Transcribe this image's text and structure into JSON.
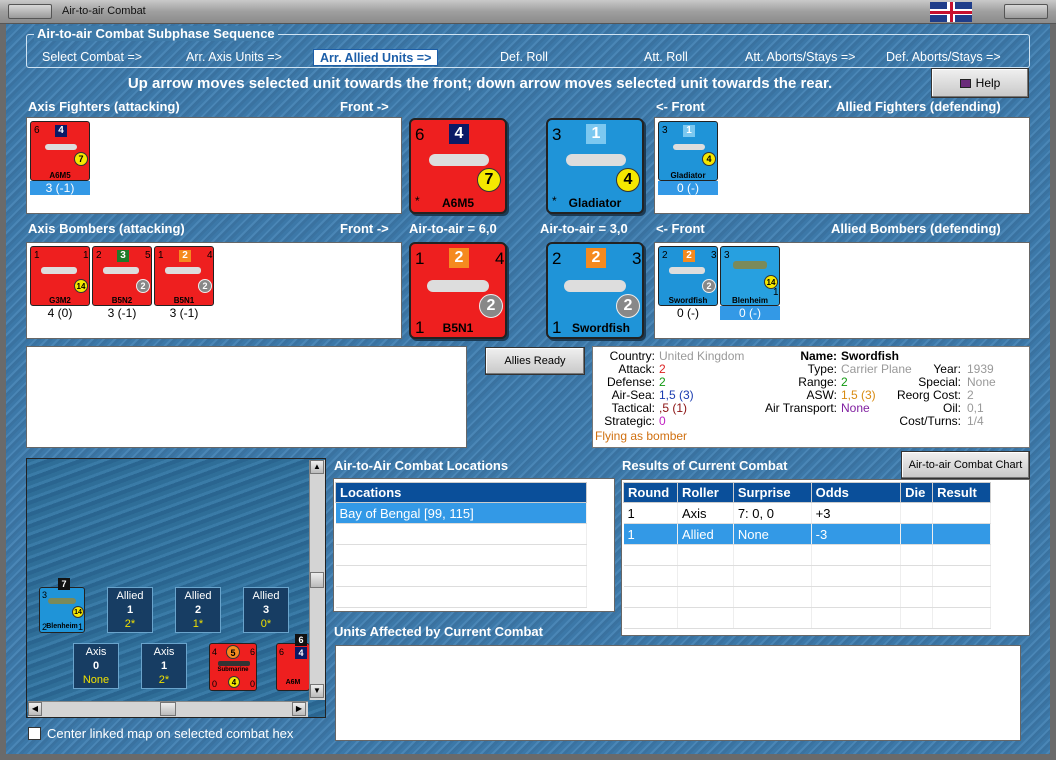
{
  "window": {
    "title": "Air-to-air Combat"
  },
  "sequence": {
    "title": "Air-to-air Combat Subphase Sequence",
    "items": [
      "Select Combat =>",
      "Arr. Axis Units =>",
      "Arr. Allied Units =>",
      "Def. Roll",
      "Att. Roll",
      "Att. Aborts/Stays =>",
      "Def. Aborts/Stays =>"
    ],
    "active": "Arr. Allied Units =>"
  },
  "instruction": "Up arrow moves selected unit towards the front; down arrow moves selected unit towards the rear.",
  "help_label": "Help",
  "labels": {
    "axis_fighters": "Axis Fighters (attacking)",
    "front_right": "Front ->",
    "front_left": "<- Front",
    "allied_fighters": "Allied Fighters (defending)",
    "axis_bombers": "Axis Bombers (attacking)",
    "allied_bombers": "Allied Bombers (defending)",
    "axis_air_to_air": "Air-to-air = 6,0",
    "allied_air_to_air": "Air-to-air = 3,0"
  },
  "axis_fighters": [
    {
      "name": "A6M5",
      "left": "6",
      "top": "4",
      "circle": "7",
      "sub": "3 (-1)",
      "selected": true
    }
  ],
  "allied_fighters": [
    {
      "name": "Gladiator",
      "left": "3",
      "top": "1",
      "circle": "4",
      "sub": "0 (-)",
      "selected": true
    }
  ],
  "axis_bombers": [
    {
      "name": "G3M2",
      "left": "1",
      "top": "",
      "right": "1",
      "circle": "14",
      "sub": "4 (0)"
    },
    {
      "name": "B5N2",
      "left": "2",
      "top": "3",
      "right": "5",
      "circle": "2",
      "sub": "3 (-1)"
    },
    {
      "name": "B5N1",
      "left": "1",
      "top": "2",
      "right": "4",
      "circle": "2",
      "sub": "3 (-1)"
    }
  ],
  "allied_bombers": [
    {
      "name": "Swordfish",
      "left": "2",
      "top": "2",
      "right": "3",
      "circle": "2",
      "sub": "0 (-)"
    },
    {
      "name": "Blenheim",
      "left": "3",
      "top": "",
      "right": "1",
      "circle": "14",
      "sub": "0 (-)",
      "selected": true
    }
  ],
  "big_cards": {
    "axis_fighter": {
      "name": "A6M5",
      "left": "6",
      "top": "4",
      "circle": "7",
      "star": "*"
    },
    "allied_fighter": {
      "name": "Gladiator",
      "left": "3",
      "top": "1",
      "circle": "4",
      "star": "*"
    },
    "axis_bomber": {
      "name": "B5N1",
      "left": "1",
      "top": "2",
      "right": "4",
      "circle": "2",
      "bottom_left": "1"
    },
    "allied_bomber": {
      "name": "Swordfish",
      "left": "2",
      "top": "2",
      "right": "3",
      "circle": "2",
      "bottom_left": "1"
    }
  },
  "allies_ready_label": "Allies Ready",
  "info": {
    "country_label": "Country:",
    "country": "United Kingdom",
    "attack_label": "Attack:",
    "attack": "2",
    "defense_label": "Defense:",
    "defense": "2",
    "airsea_label": "Air-Sea:",
    "airsea": "1,5 (3)",
    "tactical_label": "Tactical:",
    "tactical": ",5 (1)",
    "strategic_label": "Strategic:",
    "strategic": "0",
    "flying_as": "Flying as bomber",
    "name_label": "Name:",
    "name": "Swordfish",
    "type_label": "Type:",
    "type": "Carrier Plane",
    "year_label": "Year:",
    "year": "1939",
    "range_label": "Range:",
    "range": "2",
    "special_label": "Special:",
    "special": "None",
    "asw_label": "ASW:",
    "asw": "1,5 (3)",
    "reorg_label": "Reorg Cost:",
    "reorg": "2",
    "airtransport_label": "Air Transport:",
    "airtransport": "None",
    "oil_label": "Oil:",
    "oil": "0,1",
    "costturns_label": "Cost/Turns:",
    "costturns": "1/4"
  },
  "locations": {
    "title": "Air-to-Air Combat Locations",
    "header": "Locations",
    "rows": [
      "Bay of Bengal [99, 115]"
    ]
  },
  "results": {
    "title": "Results of Current Combat",
    "chart_button": "Air-to-air Combat Chart",
    "headers": [
      "Round",
      "Roller",
      "Surprise",
      "Odds",
      "Die",
      "Result"
    ],
    "rows": [
      [
        "1",
        "Axis",
        "7: 0, 0",
        "+3",
        "",
        ""
      ],
      [
        "1",
        "Allied",
        "None",
        "-3",
        "",
        ""
      ]
    ]
  },
  "affected_title": "Units Affected by Current Combat",
  "map": {
    "cells": [
      {
        "label": "Allied",
        "num": "1",
        "val": "2*"
      },
      {
        "label": "Allied",
        "num": "2",
        "val": "1*"
      },
      {
        "label": "Allied",
        "num": "3",
        "val": "0*"
      },
      {
        "label": "Axis",
        "num": "0",
        "val": "None"
      },
      {
        "label": "Axis",
        "num": "1",
        "val": "2*"
      }
    ],
    "blenheim": {
      "name": "Blenheim",
      "badge": "7",
      "circle": "14",
      "l": "3",
      "bl": "2",
      "br": "1"
    },
    "submarine": {
      "name": "Submarine",
      "top": "5",
      "l": "4",
      "r": "6",
      "circle": "4",
      "bl": "0",
      "br": "0"
    },
    "axis_unit": {
      "name": "A6M",
      "badge": "6",
      "top": "4",
      "l": "6"
    }
  },
  "checkbox_label": "Center linked map on selected combat hex",
  "colors": {
    "background": "#3d76a4",
    "axis": "#ee1f1f",
    "allied": "#1f94d8",
    "selection": "#3399e6",
    "header": "#0a4f9a"
  }
}
